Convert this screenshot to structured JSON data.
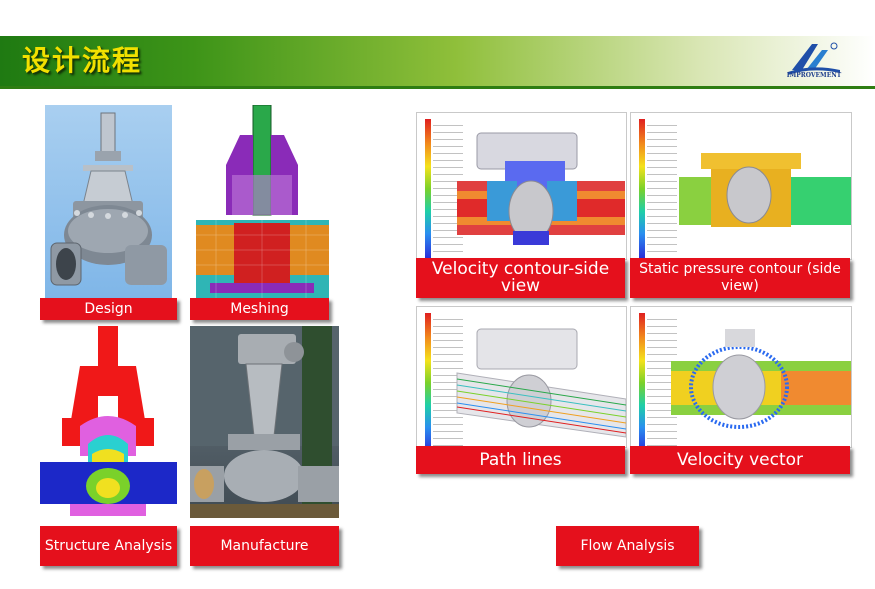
{
  "header": {
    "title": "设计流程",
    "logo_text": "IMPROVEMENT"
  },
  "left_panel": {
    "items": [
      {
        "label": "Design"
      },
      {
        "label": "Meshing"
      },
      {
        "label": "Structure Analysis"
      },
      {
        "label": "Manufacture"
      }
    ]
  },
  "right_panel": {
    "items": [
      {
        "label": "Velocity contour-side view"
      },
      {
        "label": "Static pressure contour (side view)"
      },
      {
        "label": "Path lines"
      },
      {
        "label": "Velocity vector"
      }
    ],
    "summary_label": "Flow Analysis"
  },
  "colors": {
    "accent": "#e5101c",
    "header_green": "#2e7d12",
    "title_yellow": "#f2e000"
  }
}
